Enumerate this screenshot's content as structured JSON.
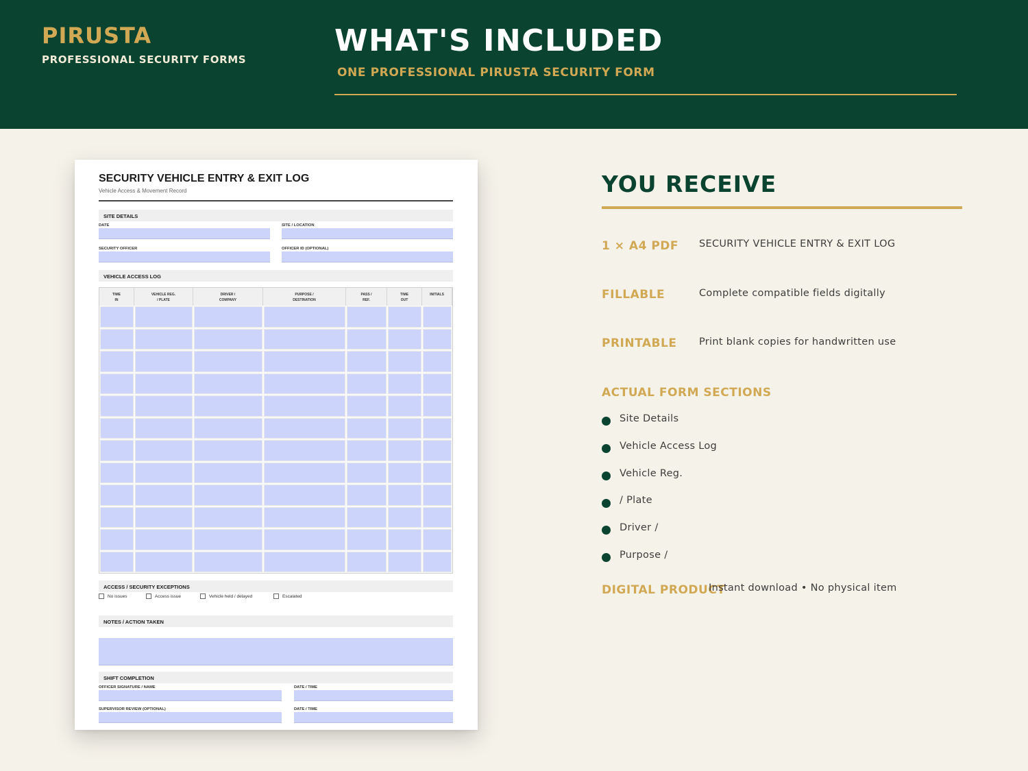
{
  "header": {
    "brand_name": "PIRUSTA",
    "brand_tagline": "PROFESSIONAL SECURITY FORMS",
    "title": "WHAT'S INCLUDED",
    "subtitle": "ONE PROFESSIONAL PIRUSTA SECURITY FORM"
  },
  "form": {
    "title": "SECURITY VEHICLE ENTRY & EXIT LOG",
    "subtitle": "Vehicle Access & Movement Record",
    "site_details": {
      "heading": "SITE DETAILS",
      "date_label": "DATE",
      "site_label": "SITE / LOCATION",
      "officer_label": "SECURITY OFFICER",
      "officer_id_label": "OFFICER ID (OPTIONAL)"
    },
    "access_log": {
      "heading": "VEHICLE ACCESS LOG",
      "columns": [
        "TIME\nIN",
        "VEHICLE REG.\n/ PLATE",
        "DRIVER /\nCOMPANY",
        "PURPOSE /\nDESTINATION",
        "PASS /\nREF.",
        "TIME\nOUT",
        "INITIALS"
      ],
      "row_count": 12
    },
    "exceptions": {
      "heading": "ACCESS / SECURITY EXCEPTIONS",
      "options": [
        "No issues",
        "Access issue",
        "Vehicle held / delayed",
        "Escalated"
      ]
    },
    "notes": {
      "heading": "NOTES / ACTION TAKEN"
    },
    "shift": {
      "heading": "SHIFT COMPLETION",
      "officer_sig_label": "OFFICER SIGNATURE / NAME",
      "date_time_label_1": "DATE / TIME",
      "supervisor_label": "SUPERVISOR REVIEW (OPTIONAL)",
      "date_time_label_2": "DATE / TIME"
    }
  },
  "panel": {
    "title": "YOU RECEIVE",
    "features": [
      {
        "label": "1 × A4 PDF",
        "text": "SECURITY VEHICLE ENTRY & EXIT LOG"
      },
      {
        "label": "FILLABLE",
        "text": "Complete compatible fields digitally"
      },
      {
        "label": "PRINTABLE",
        "text": "Print blank copies for handwritten use"
      }
    ],
    "sections_heading": "ACTUAL FORM SECTIONS",
    "sections": [
      "Site Details",
      "Vehicle Access Log",
      "Vehicle Reg.",
      "/ Plate",
      "Driver /",
      "Purpose /"
    ],
    "digital_label": "DIGITAL PRODUCT",
    "digital_text": "Instant download • No physical item"
  },
  "colors": {
    "primary_green": "#0a432f",
    "gold": "#d1a954",
    "background": "#f5f2ea",
    "field_fill": "#cdd4fb"
  }
}
